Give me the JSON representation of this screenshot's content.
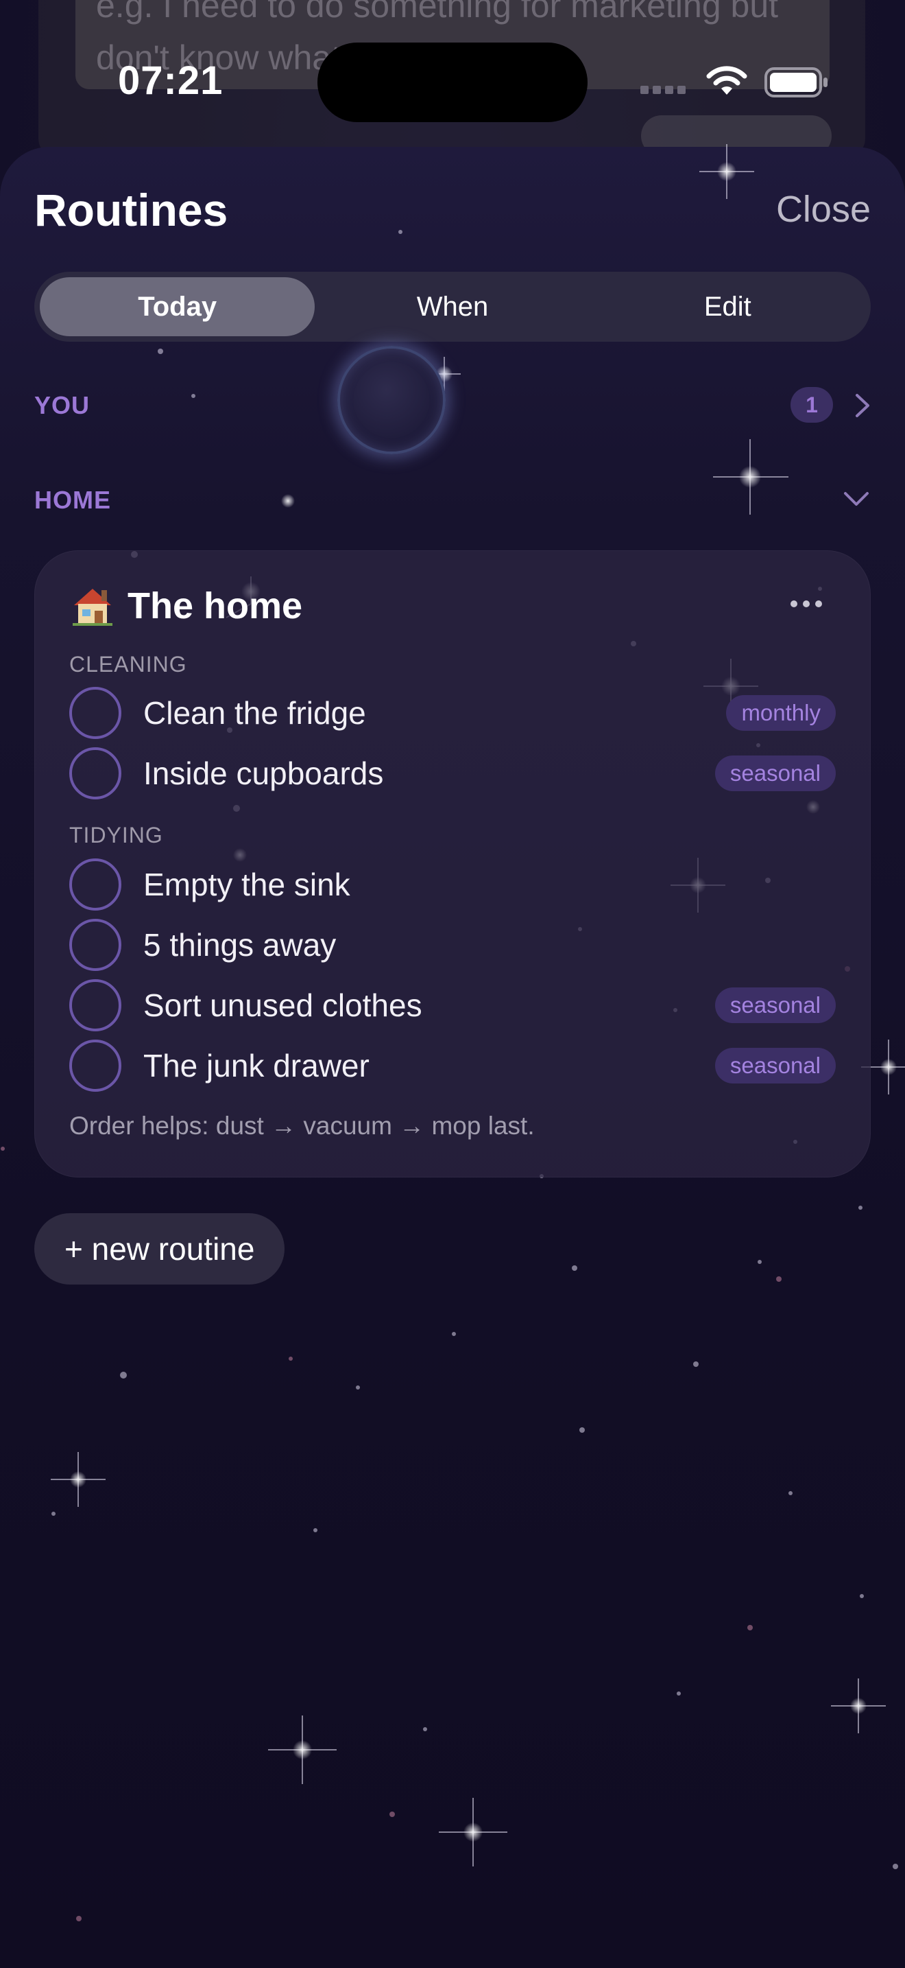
{
  "background_app": {
    "input_placeholder": "e.g. I need to do something for marketing but don't know what"
  },
  "status_bar": {
    "time": "07:21",
    "signal_icon": "signal-bars-icon",
    "wifi_icon": "wifi-icon",
    "battery_icon": "battery-full-icon"
  },
  "sheet": {
    "title": "Routines",
    "close_label": "Close"
  },
  "tabs": [
    {
      "label": "Today",
      "selected": true
    },
    {
      "label": "When",
      "selected": false
    },
    {
      "label": "Edit",
      "selected": false
    }
  ],
  "sections": {
    "you": {
      "label": "YOU",
      "count": "1",
      "icon": "chevron-right-icon"
    },
    "home": {
      "label": "HOME",
      "icon": "chevron-down-icon"
    }
  },
  "routine": {
    "emoji_icon": "house-icon",
    "title": "The home",
    "menu_icon": "ellipsis-icon",
    "groups": [
      {
        "label": "CLEANING",
        "tasks": [
          {
            "label": "Clean the fridge",
            "tag": "monthly"
          },
          {
            "label": "Inside cupboards",
            "tag": "seasonal"
          }
        ]
      },
      {
        "label": "TIDYING",
        "tasks": [
          {
            "label": "Empty the sink",
            "tag": ""
          },
          {
            "label": "5 things away",
            "tag": ""
          },
          {
            "label": "Sort unused clothes",
            "tag": "seasonal"
          },
          {
            "label": "The junk drawer",
            "tag": "seasonal"
          }
        ]
      }
    ],
    "note": "Order helps: dust → vacuum → mop last."
  },
  "new_routine_label": "+ new routine",
  "colors": {
    "accent": "#9c78d6",
    "tag_bg": "#3c2f66",
    "tag_text": "#a483e0",
    "checkbox_ring": "#6b56a8",
    "background": "#13102a"
  }
}
